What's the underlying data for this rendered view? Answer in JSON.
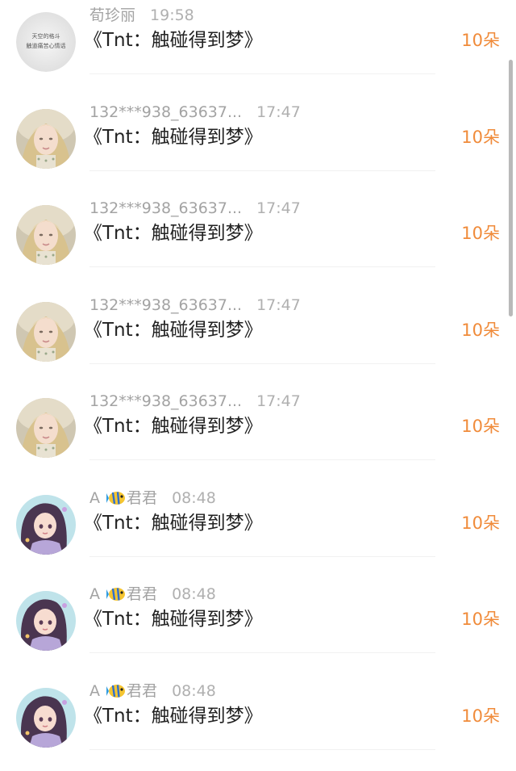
{
  "rows": [
    {
      "name": "荀珍丽",
      "badge": "",
      "time": "19:58",
      "title": "《Tnt：触碰得到梦》",
      "amount": "10朵",
      "avatar": "calligraphy"
    },
    {
      "name": "132***938_63637...",
      "badge": "",
      "time": "17:47",
      "title": "《Tnt：触碰得到梦》",
      "amount": "10朵",
      "avatar": "blonde-girl"
    },
    {
      "name": "132***938_63637...",
      "badge": "",
      "time": "17:47",
      "title": "《Tnt：触碰得到梦》",
      "amount": "10朵",
      "avatar": "blonde-girl"
    },
    {
      "name": "132***938_63637...",
      "badge": "",
      "time": "17:47",
      "title": "《Tnt：触碰得到梦》",
      "amount": "10朵",
      "avatar": "blonde-girl"
    },
    {
      "name": "132***938_63637...",
      "badge": "",
      "time": "17:47",
      "title": "《Tnt：触碰得到梦》",
      "amount": "10朵",
      "avatar": "blonde-girl"
    },
    {
      "name": "A",
      "badge": "君君",
      "time": "08:48",
      "title": "《Tnt：触碰得到梦》",
      "amount": "10朵",
      "avatar": "cartoon-girl"
    },
    {
      "name": "A",
      "badge": "君君",
      "time": "08:48",
      "title": "《Tnt：触碰得到梦》",
      "amount": "10朵",
      "avatar": "cartoon-girl"
    },
    {
      "name": "A",
      "badge": "君君",
      "time": "08:48",
      "title": "《Tnt：触碰得到梦》",
      "amount": "10朵",
      "avatar": "cartoon-girl"
    }
  ],
  "avatar_texts": {
    "calligraphy_line1": "天空的格斗",
    "calligraphy_line2": "触道痛苦心情话"
  },
  "colors": {
    "amount": "#f08b3a",
    "name": "#a3a3a3",
    "title": "#222222",
    "divider": "#f1f1f1"
  },
  "icons": {
    "fish": "fish-emoji-icon"
  }
}
